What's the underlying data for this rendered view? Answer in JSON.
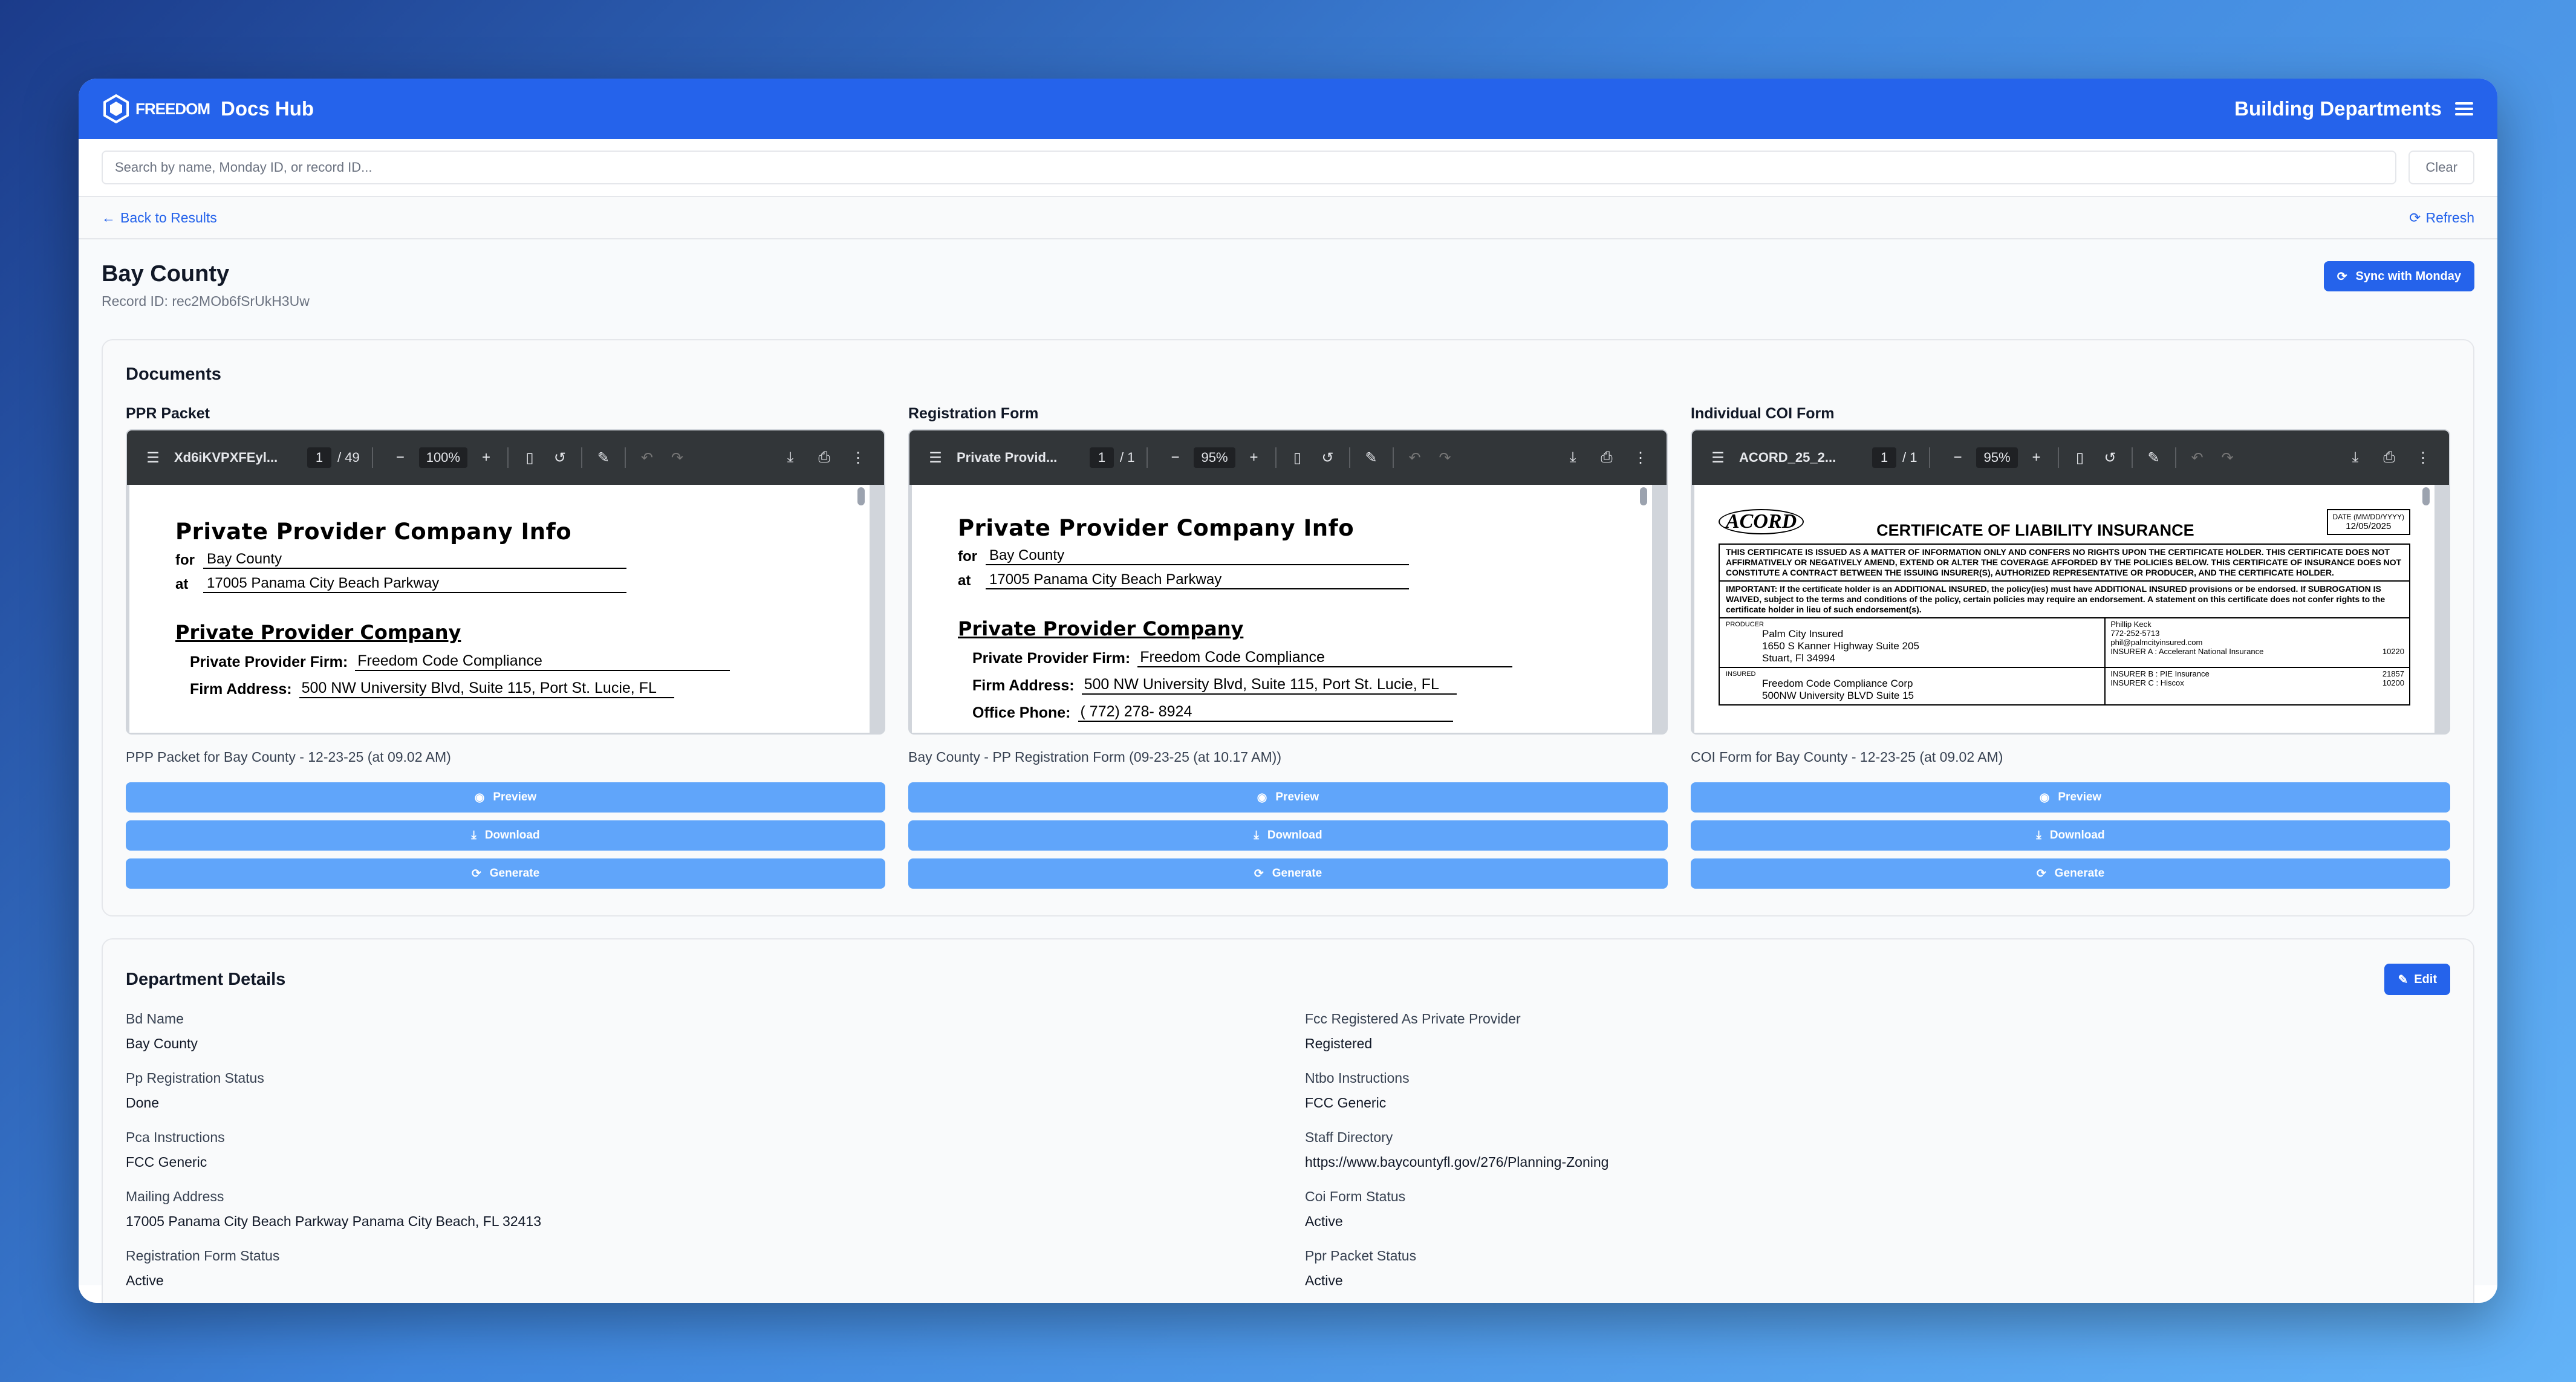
{
  "header": {
    "brand": "FREEDOM",
    "app_title": "Docs Hub",
    "section": "Building Departments"
  },
  "search": {
    "placeholder": "Search by name, Monday ID, or record ID...",
    "clear_label": "Clear"
  },
  "nav": {
    "back_label": "Back to Results",
    "refresh_label": "Refresh"
  },
  "record": {
    "title": "Bay County",
    "record_id": "Record ID: rec2MOb6fSrUkH3Uw",
    "sync_label": "Sync with Monday"
  },
  "documents": {
    "title": "Documents",
    "buttons": {
      "preview": "Preview",
      "download": "Download",
      "generate": "Generate"
    },
    "items": [
      {
        "label": "PPR Packet",
        "viewer": {
          "filename": "Xd6iKVPXFEyl...",
          "page": "1",
          "pages": "/ 49",
          "zoom": "100%"
        },
        "caption": "PPP Packet for Bay County - 12-23-25 (at 09.02 AM)"
      },
      {
        "label": "Registration Form",
        "viewer": {
          "filename": "Private Provid...",
          "page": "1",
          "pages": "/  1",
          "zoom": "95%"
        },
        "caption": "Bay County - PP Registration Form (09-23-25 (at 10.17 AM))"
      },
      {
        "label": "Individual COI Form",
        "viewer": {
          "filename": "ACORD_25_2...",
          "page": "1",
          "pages": "/  1",
          "zoom": "95%"
        },
        "caption": "COI Form for Bay County - 12-23-25 (at 09.02 AM)"
      }
    ],
    "ppr_page": {
      "heading": "Private Provider Company Info",
      "for_label": "for",
      "for_value": "Bay County",
      "at_label": "at",
      "at_value": "17005 Panama City Beach Parkway",
      "subheading": "Private Provider Company",
      "firm_label": "Private Provider Firm:",
      "firm_value": "Freedom Code Compliance",
      "address_label": "Firm Address:",
      "address_value": "500 NW University Blvd, Suite 115, Port St. Lucie, FL",
      "phone_label": "Office Phone:",
      "phone_value": "( 772)  278-  8924"
    },
    "coi_page": {
      "logo": "ACORD",
      "title": "CERTIFICATE OF LIABILITY INSURANCE",
      "date_label": "DATE (MM/DD/YYYY)",
      "date_value": "12/05/2025",
      "notice": "THIS CERTIFICATE IS ISSUED AS A MATTER OF INFORMATION ONLY AND CONFERS NO RIGHTS UPON THE CERTIFICATE HOLDER. THIS CERTIFICATE DOES NOT AFFIRMATIVELY OR NEGATIVELY AMEND, EXTEND OR ALTER THE COVERAGE AFFORDED BY THE POLICIES BELOW. THIS CERTIFICATE OF INSURANCE DOES NOT CONSTITUTE A CONTRACT BETWEEN THE ISSUING INSURER(S), AUTHORIZED REPRESENTATIVE OR PRODUCER, AND THE CERTIFICATE HOLDER.",
      "important": "IMPORTANT: If the certificate holder is an ADDITIONAL INSURED, the policy(ies) must have ADDITIONAL INSURED provisions or be endorsed. If SUBROGATION IS WAIVED, subject to the terms and conditions of the policy, certain policies may require an endorsement. A statement on this certificate does not confer rights to the certificate holder in lieu of such endorsement(s).",
      "producer_label": "PRODUCER",
      "producer": "Palm City Insured",
      "producer_addr1": "1650 S Kanner Highway  Suite 205",
      "producer_addr2": "Stuart, Fl 34994",
      "contact": "Phillip Keck",
      "phone": "772-252-5713",
      "email": "phil@palmcityinsured.com",
      "insured_label": "INSURED",
      "insured": "Freedom Code Compliance Corp",
      "insured_addr": "500NW University BLVD Suite 15",
      "insurer_a": "INSURER A : Accelerant National Insurance",
      "insurer_a_naic": "10220",
      "insurer_b": "INSURER B : PIE Insurance",
      "insurer_b_naic": "21857",
      "insurer_c": "INSURER C : Hiscox",
      "insurer_c_naic": "10200"
    }
  },
  "details": {
    "title": "Department Details",
    "edit_label": "Edit",
    "fields": [
      {
        "label": "Bd Name",
        "value": "Bay County"
      },
      {
        "label": "Fcc Registered As Private Provider",
        "value": "Registered"
      },
      {
        "label": "Pp Registration Status",
        "value": "Done"
      },
      {
        "label": "Ntbo Instructions",
        "value": "FCC Generic"
      },
      {
        "label": "Pca Instructions",
        "value": "FCC Generic"
      },
      {
        "label": "Staff Directory",
        "value": "https://www.baycountyfl.gov/276/Planning-Zoning"
      },
      {
        "label": "Mailing Address",
        "value": "17005 Panama City Beach Parkway Panama City Beach, FL 32413"
      },
      {
        "label": "Coi Form Status",
        "value": "Active"
      },
      {
        "label": "Registration Form Status",
        "value": "Active"
      },
      {
        "label": "Ppr Packet Status",
        "value": "Active"
      }
    ]
  },
  "colors": {
    "primary": "#2563eb",
    "button_light": "#60a5fa",
    "viewer_toolbar": "#323639"
  }
}
